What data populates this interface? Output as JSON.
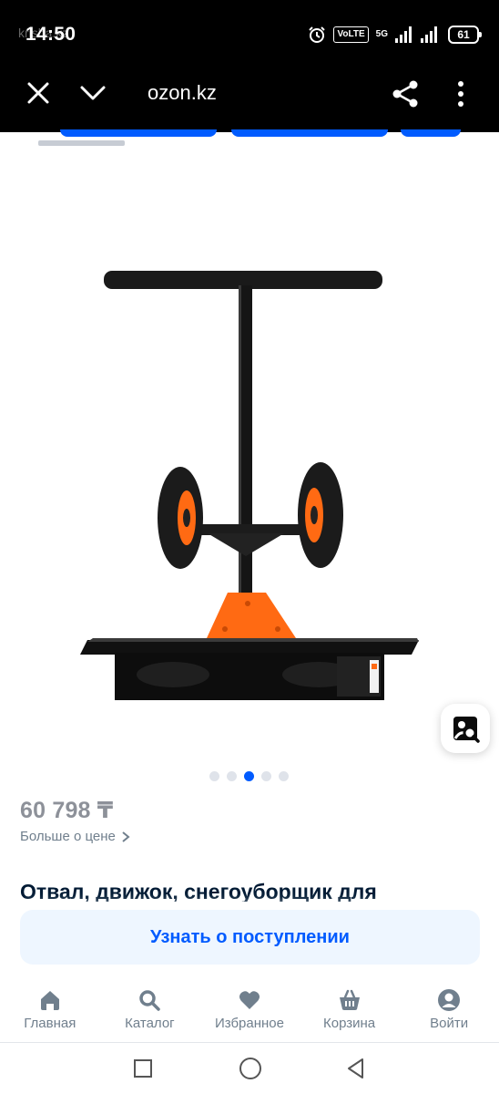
{
  "status_bar": {
    "time": "14:50",
    "watermark": "krisha.kz",
    "volte": "VoLTE",
    "network": "5G",
    "battery": "61"
  },
  "browser_header": {
    "url": "ozon.kz",
    "close_icon": "close-icon",
    "collapse_icon": "chevron-down-icon",
    "share_icon": "share-icon",
    "menu_icon": "more-vertical-icon"
  },
  "gallery": {
    "image": "snow-shovel-plow-with-wheels",
    "dots_count": 5,
    "active_dot": 3,
    "visual_search_icon": "image-search-icon"
  },
  "product": {
    "price": "60 798 ₸",
    "more_about_price": "Больше о цене",
    "title": "Отвал, движок, снегоуборщик для"
  },
  "notify_button": "Узнать о поступлении",
  "bottom_nav": [
    {
      "label": "Главная",
      "icon": "home-icon"
    },
    {
      "label": "Каталог",
      "icon": "search-icon"
    },
    {
      "label": "Избранное",
      "icon": "heart-icon"
    },
    {
      "label": "Корзина",
      "icon": "basket-icon"
    },
    {
      "label": "Войти",
      "icon": "account-icon"
    }
  ],
  "colors": {
    "accent": "#005bff",
    "price_grey": "#8d9199",
    "nav_grey": "#707f8d",
    "product_orange": "#ff6a13"
  }
}
